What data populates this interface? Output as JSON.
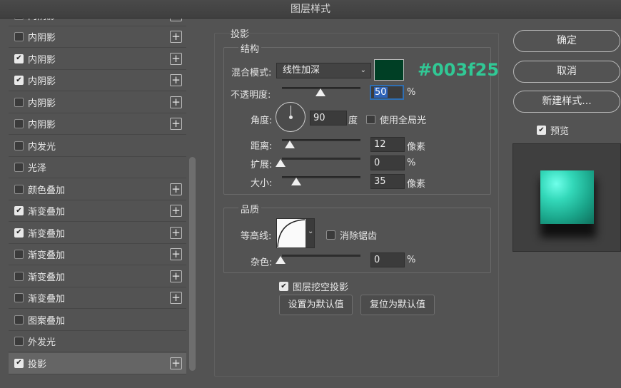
{
  "window": {
    "title": "图层样式"
  },
  "styles_list": {
    "items": [
      {
        "label": "内阴影",
        "checked": false,
        "has_plus": true,
        "selected": false,
        "partial": true
      },
      {
        "label": "内阴影",
        "checked": false,
        "has_plus": true,
        "selected": false
      },
      {
        "label": "内阴影",
        "checked": true,
        "has_plus": true,
        "selected": false
      },
      {
        "label": "内阴影",
        "checked": true,
        "has_plus": true,
        "selected": false
      },
      {
        "label": "内阴影",
        "checked": false,
        "has_plus": true,
        "selected": false
      },
      {
        "label": "内阴影",
        "checked": false,
        "has_plus": true,
        "selected": false
      },
      {
        "label": "内发光",
        "checked": false,
        "has_plus": false,
        "selected": false
      },
      {
        "label": "光泽",
        "checked": false,
        "has_plus": false,
        "selected": false
      },
      {
        "label": "颜色叠加",
        "checked": false,
        "has_plus": true,
        "selected": false
      },
      {
        "label": "渐变叠加",
        "checked": true,
        "has_plus": true,
        "selected": false
      },
      {
        "label": "渐变叠加",
        "checked": true,
        "has_plus": true,
        "selected": false
      },
      {
        "label": "渐变叠加",
        "checked": false,
        "has_plus": true,
        "selected": false
      },
      {
        "label": "渐变叠加",
        "checked": false,
        "has_plus": true,
        "selected": false
      },
      {
        "label": "渐变叠加",
        "checked": false,
        "has_plus": true,
        "selected": false
      },
      {
        "label": "图案叠加",
        "checked": false,
        "has_plus": false,
        "selected": false
      },
      {
        "label": "外发光",
        "checked": false,
        "has_plus": false,
        "selected": false
      },
      {
        "label": "投影",
        "checked": true,
        "has_plus": true,
        "selected": true
      }
    ]
  },
  "drop_shadow": {
    "section_title": "投影",
    "structure_title": "结构",
    "blend_mode_label": "混合模式:",
    "blend_mode_value": "线性加深",
    "shadow_color": "#003f25",
    "color_annotation": "#003f25",
    "opacity_label": "不透明度:",
    "opacity_value": "50",
    "opacity_unit": "%",
    "opacity_fraction": 0.5,
    "angle_label": "角度:",
    "angle_value": "90",
    "angle_unit": "度",
    "use_global_light_label": "使用全局光",
    "use_global_light_checked": false,
    "distance_label": "距离:",
    "distance_value": "12",
    "distance_unit": "像素",
    "spread_label": "扩展:",
    "spread_value": "0",
    "spread_unit": "%",
    "size_label": "大小:",
    "size_value": "35",
    "size_unit": "像素",
    "quality_title": "品质",
    "contour_label": "等高线:",
    "anti_alias_label": "消除锯齿",
    "anti_alias_checked": false,
    "noise_label": "杂色:",
    "noise_value": "0",
    "noise_unit": "%",
    "knockout_label": "图层挖空投影",
    "knockout_checked": true,
    "make_default_label": "设置为默认值",
    "reset_default_label": "复位为默认值"
  },
  "actions": {
    "ok_label": "确定",
    "cancel_label": "取消",
    "new_style_label": "新建样式...",
    "preview_label": "预览",
    "preview_checked": true
  },
  "colors": {
    "accent_selection": "#2e63b8",
    "preview_cube": "#33d8b9",
    "annotation_text": "#31c895"
  }
}
